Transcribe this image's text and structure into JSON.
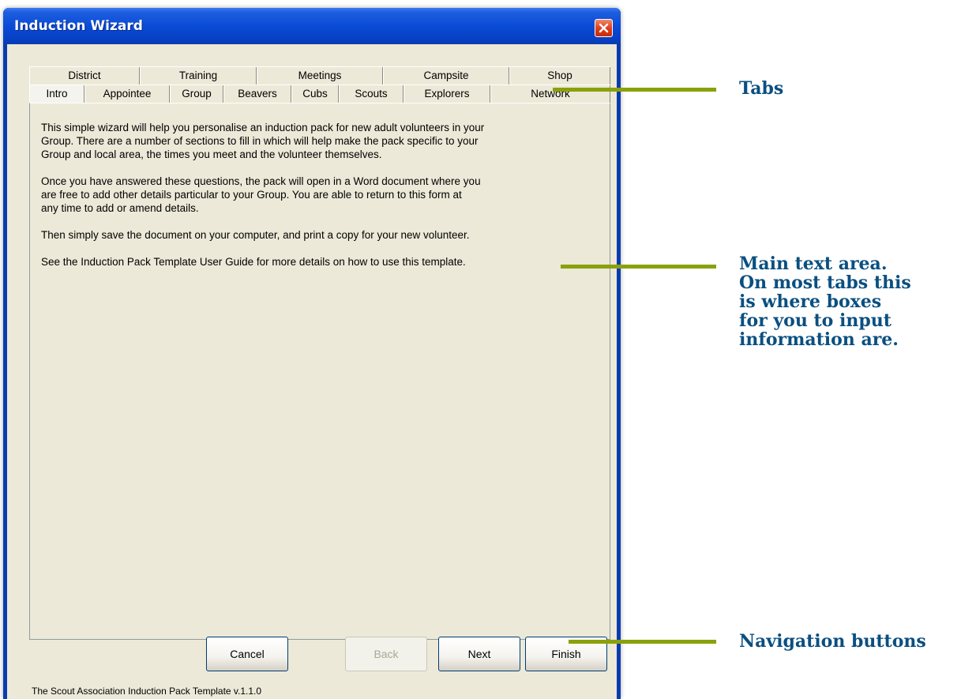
{
  "window": {
    "title": "Induction Wizard",
    "close_icon": "close-icon"
  },
  "tabs": {
    "back_row": [
      "District",
      "Training",
      "Meetings",
      "Campsite",
      "Shop"
    ],
    "front_row": [
      "Intro",
      "Appointee",
      "Group",
      "Beavers",
      "Cubs",
      "Scouts",
      "Explorers",
      "Network"
    ],
    "active": "Intro"
  },
  "intro": {
    "paragraph_1_lines": [
      "This simple wizard will help you personalise an induction pack for new adult volunteers in your",
      "Group.  There are a number of sections to fill in which will help make the pack specific to your",
      "Group and local area, the times you meet and the volunteer themselves."
    ],
    "paragraph_2_lines": [
      "Once you have answered these questions, the pack will open in a Word document where you",
      "are free to add other details particular to your Group.  You are able to return to this form at",
      "any time to add or amend details."
    ],
    "paragraph_3": "Then simply save the document on your computer, and print a copy for your new volunteer.",
    "paragraph_4": "See the Induction Pack Template User Guide for more details on how to use this template."
  },
  "buttons": {
    "cancel": "Cancel",
    "back": "Back",
    "next": "Next",
    "finish": "Finish"
  },
  "footer": "The Scout Association Induction Pack Template v.1.1.0",
  "callouts": {
    "tabs": "Tabs",
    "main_area": [
      "Main text area.",
      "On most tabs this",
      "is where boxes",
      "for you to input",
      "information are."
    ],
    "nav": "Navigation buttons"
  },
  "colors": {
    "callout_text": "#0a4f80",
    "callout_line": "#8aa10c",
    "titlebar": "#0a4bd6",
    "dialog_bg": "#ece9d8"
  }
}
